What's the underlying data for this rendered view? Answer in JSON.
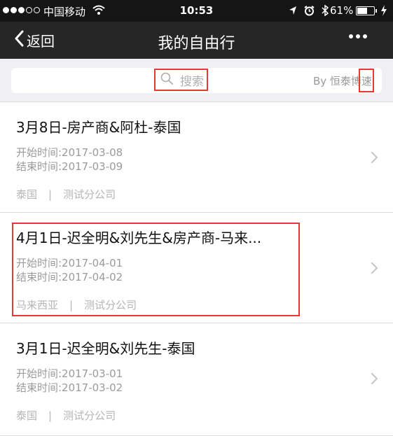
{
  "status_bar": {
    "carrier": "中国移动",
    "time": "10:53",
    "battery_percent": "61%",
    "battery_level": 0.61
  },
  "nav": {
    "back_label": "返回",
    "title": "我的自由行"
  },
  "search": {
    "placeholder": "搜索",
    "powered_by": "By 恒泰博速"
  },
  "trips": [
    {
      "title": "3月8日-房产商&阿杜-泰国",
      "start": "开始时间:2017-03-08",
      "end": "结束时间:2017-03-09",
      "country": "泰国",
      "company": "测试分公司"
    },
    {
      "title": "4月1日-迟全明&刘先生&房产商-马来...",
      "start": "开始时间:2017-04-01",
      "end": "结束时间:2017-04-02",
      "country": "马来西亚",
      "company": "测试分公司"
    },
    {
      "title": "3月1日-迟全明&刘先生-泰国",
      "start": "开始时间:2017-03-01",
      "end": "结束时间:2017-03-02",
      "country": "泰国",
      "company": "测试分公司"
    }
  ],
  "colors": {
    "status_bar_bg": "#151515",
    "nav_bg": "#262626",
    "highlight": "#e53935"
  }
}
